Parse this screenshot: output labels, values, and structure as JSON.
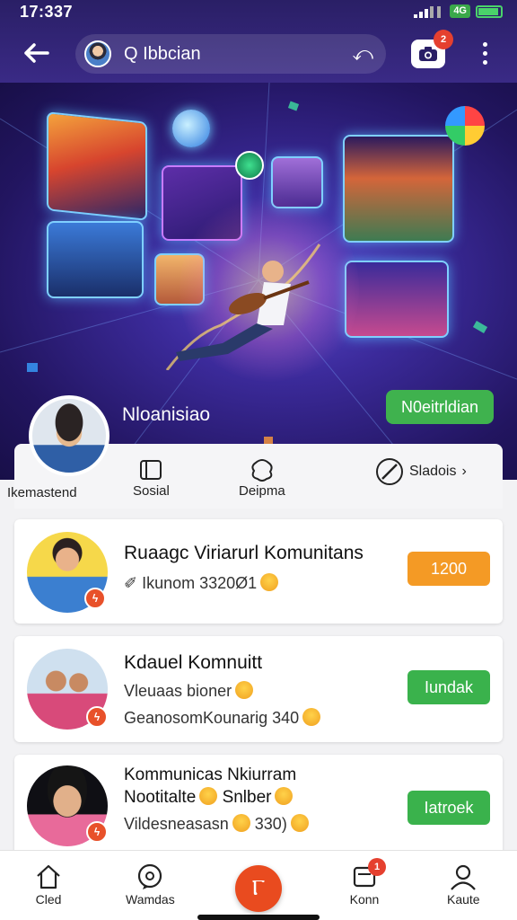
{
  "status_bar": {
    "time": "17:337",
    "network": "4G"
  },
  "header": {
    "search_value": "Ibbcian",
    "search_action_glyph": "⤺",
    "camera_badge": "2"
  },
  "profile": {
    "name": "Nloanisiao",
    "notification_button": "N0eitrldian"
  },
  "quick_actions": [
    {
      "label": "Ikemastend",
      "icon": "profile-icon"
    },
    {
      "label": "Sosial",
      "icon": "tablet-icon"
    },
    {
      "label": "Deipma",
      "icon": "puzzle-icon"
    },
    {
      "label": "Sladois",
      "icon": "compass-icon"
    }
  ],
  "communities": [
    {
      "title": "Ruaagc Viriarurl Komunitans",
      "line1": "Ikunom 3320Ø1",
      "line2": "",
      "button": "1200",
      "button_color": "#f49a25"
    },
    {
      "title": "Kdauel Komnuitt",
      "line1": "Vleuaas bioner",
      "line2": "GeanosomKounarig 340",
      "button": "Iundak",
      "button_color": "#3ab24c"
    },
    {
      "title": "Kommunicas Nkiurram",
      "title2": "Nootitalte",
      "title2_suffix": "Snlber",
      "line1": "Vildesneasasn",
      "line1_suffix": "330)",
      "button": "Iatroek",
      "button_color": "#3ab24c"
    }
  ],
  "bottom_nav": [
    {
      "label": "Cled",
      "icon": "home-icon"
    },
    {
      "label": "Wamdas",
      "icon": "chat-icon"
    },
    {
      "label": "Konn",
      "icon": "inbox-icon",
      "badge": "1"
    },
    {
      "label": "Kaute",
      "icon": "user-icon"
    }
  ],
  "colors": {
    "header_bg": "#2a1f66",
    "accent_green": "#3fb24e",
    "accent_orange": "#f49a25",
    "fab": "#e94b1f"
  }
}
